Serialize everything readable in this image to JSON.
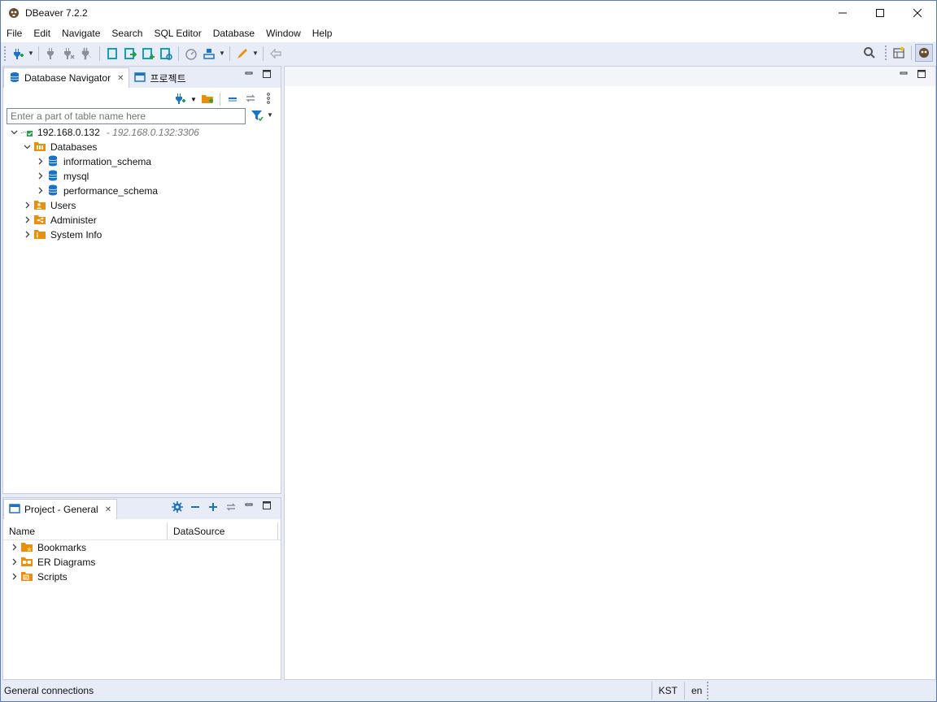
{
  "window": {
    "title": "DBeaver 7.2.2",
    "minimize_glyph": "—",
    "maximize_glyph": "☐",
    "close_glyph": "✕"
  },
  "menu": [
    "File",
    "Edit",
    "Navigate",
    "Search",
    "SQL Editor",
    "Database",
    "Window",
    "Help"
  ],
  "toolbar": {
    "icons": [
      "new-connection-icon",
      "connect-icon",
      "disconnect-icon",
      "invalidate-icon",
      "sql-editor-icon",
      "open-sql-script-icon",
      "new-sql-script-icon",
      "recent-sql-script-icon",
      "dashboard-icon",
      "transaction-mode-icon",
      "commit-icon",
      "back-icon"
    ],
    "right_icons": [
      "search-icon",
      "open-perspective-icon",
      "dbeaver-perspective-icon"
    ]
  },
  "navigator": {
    "tab_label": "Database Navigator",
    "project_tab_label": "프로젝트",
    "filter_placeholder": "Enter a part of table name here",
    "connection": {
      "name": "192.168.0.132",
      "suffix": "- 192.168.0.132:3306"
    },
    "databases_label": "Databases",
    "schemas": [
      "information_schema",
      "mysql",
      "performance_schema"
    ],
    "nodes": [
      "Users",
      "Administer",
      "System Info"
    ]
  },
  "project": {
    "tab_label": "Project - General",
    "columns": [
      "Name",
      "DataSource"
    ],
    "items": [
      "Bookmarks",
      "ER Diagrams",
      "Scripts"
    ]
  },
  "status": {
    "left": "General connections",
    "timezone": "KST",
    "locale": "en"
  },
  "colors": {
    "accent": "#1a73c7",
    "folder": "#e8900c",
    "background": "#e8ecf7"
  }
}
